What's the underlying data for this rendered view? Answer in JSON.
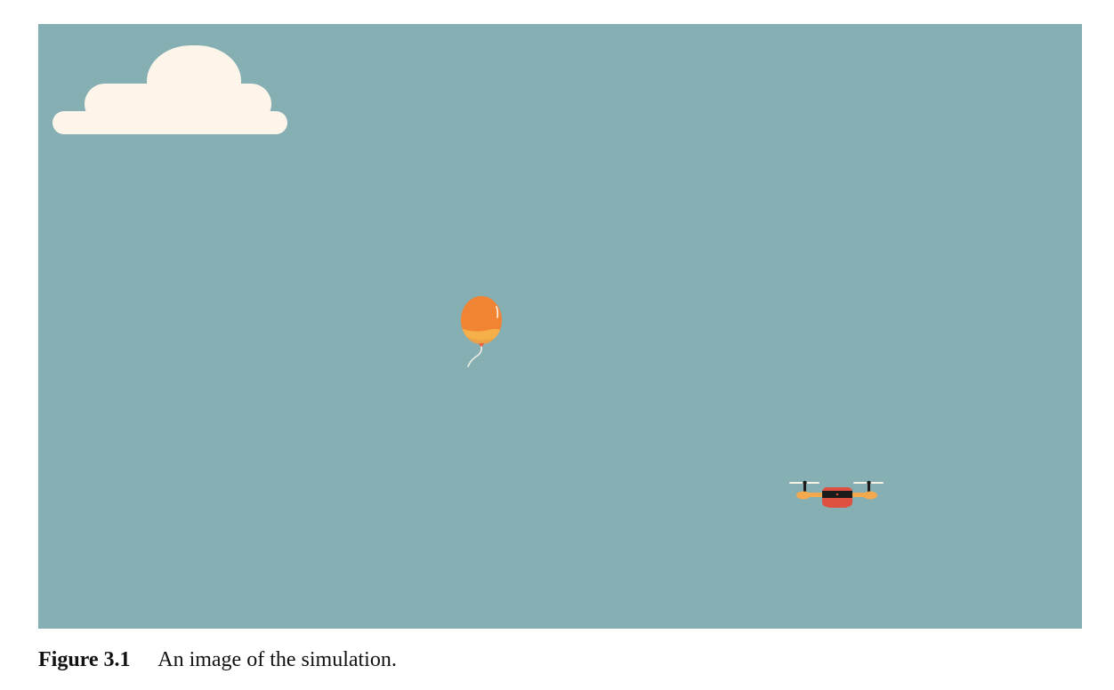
{
  "figure": {
    "label": "Figure 3.1",
    "caption": "An image of the simulation."
  },
  "scene": {
    "sky_color": "#85afb3",
    "objects": [
      {
        "kind": "cloud",
        "color": "#fdf5e9"
      },
      {
        "kind": "balloon",
        "colors": [
          "#f08433",
          "#f5b04a",
          "#e8633a"
        ]
      },
      {
        "kind": "drone",
        "colors": [
          "#de5040",
          "#f5a94f",
          "#1b1b1b"
        ]
      }
    ]
  }
}
